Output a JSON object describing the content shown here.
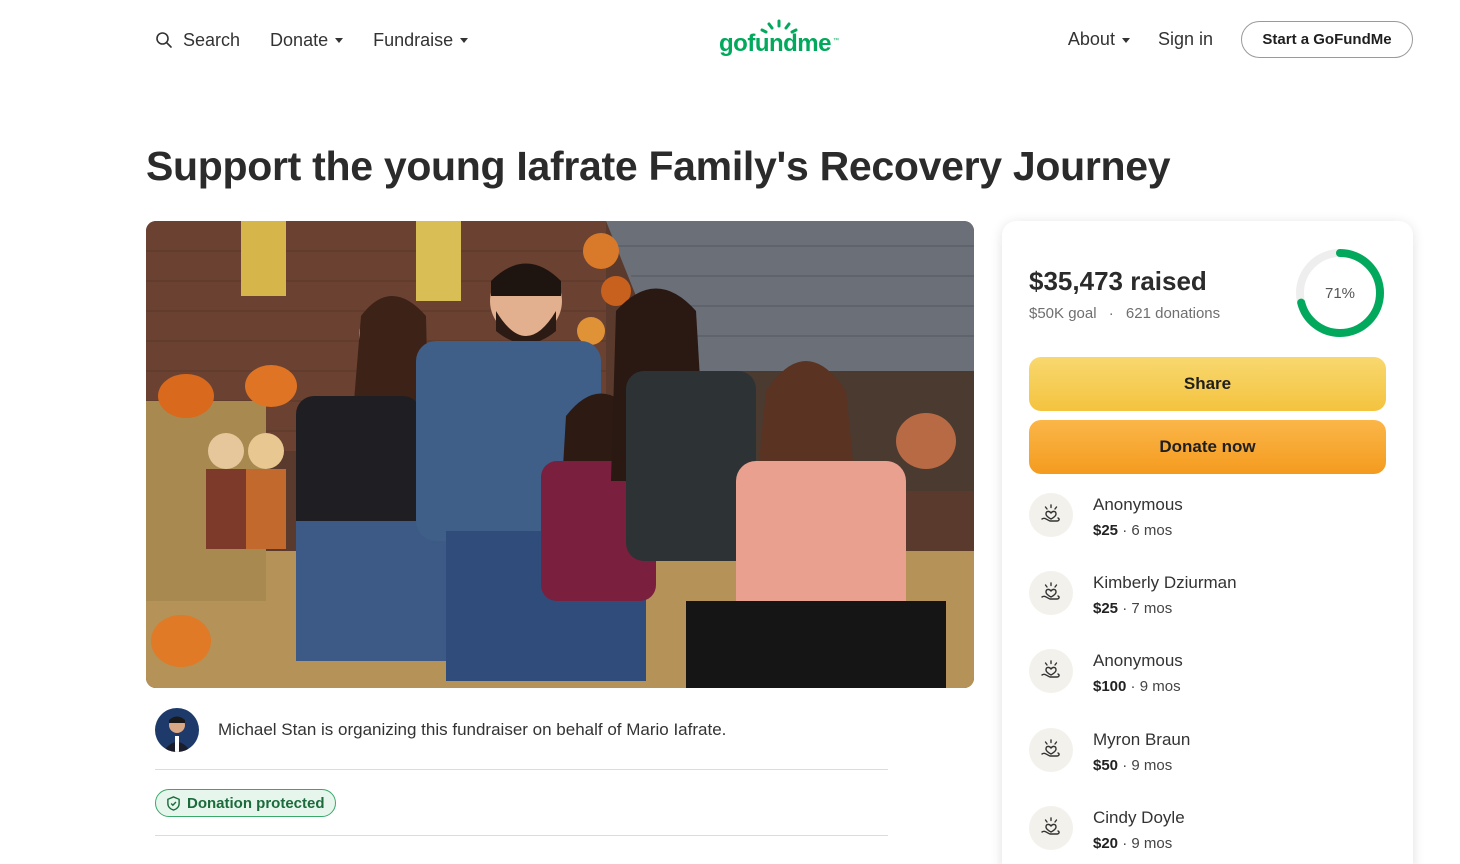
{
  "header": {
    "search_label": "Search",
    "donate_label": "Donate",
    "fundraise_label": "Fundraise",
    "logo_text": "gofundme",
    "logo_tm": "™",
    "about_label": "About",
    "signin_label": "Sign in",
    "start_label": "Start a GoFundMe"
  },
  "campaign": {
    "title": "Support the young Iafrate Family's Recovery Journey",
    "organizer_text": "Michael Stan is organizing this fundraiser on behalf of Mario Iafrate.",
    "protected_label": "Donation protected"
  },
  "sidebar": {
    "raised": "$35,473 raised",
    "goal": "$50K goal",
    "separator": "·",
    "donations": "621 donations",
    "progress_label": "71%",
    "progress_fraction": 0.71,
    "share_label": "Share",
    "donate_now_label": "Donate now",
    "donors": [
      {
        "name": "Anonymous",
        "amount": "$25",
        "time": "6 mos"
      },
      {
        "name": "Kimberly Dziurman",
        "amount": "$25",
        "time": "7 mos"
      },
      {
        "name": "Anonymous",
        "amount": "$100",
        "time": "9 mos"
      },
      {
        "name": "Myron Braun",
        "amount": "$50",
        "time": "9 mos"
      },
      {
        "name": "Cindy Doyle",
        "amount": "$20",
        "time": "9 mos"
      }
    ]
  },
  "colors": {
    "brand_green": "#02a95c",
    "share_yellow": "#f4c33f",
    "donate_orange": "#f49b1f"
  }
}
